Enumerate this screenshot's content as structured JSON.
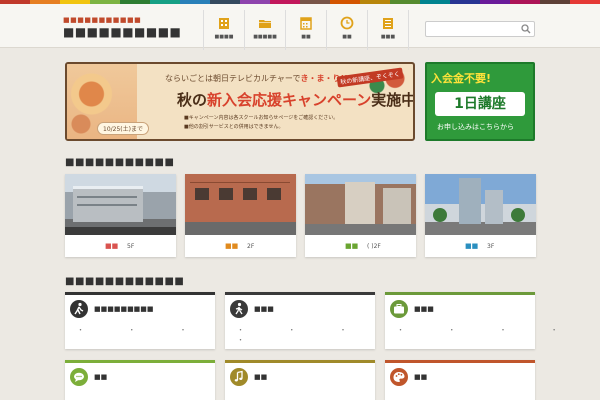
{
  "stripe_colors": [
    "#c0392b",
    "#e67e22",
    "#f1c40f",
    "#7cb342",
    "#2e7d32",
    "#16a085",
    "#2980b9",
    "#34495e",
    "#8e44ad",
    "#c2185b",
    "#795548",
    "#d35400",
    "#b8860b",
    "#558b2f",
    "#00838f",
    "#283593",
    "#6a1b9a",
    "#ad1457",
    "#5d4037",
    "#e53935"
  ],
  "header": {
    "logo_sub": "■■■■■■■■■■■",
    "logo_main": "■■■■■■■■■■",
    "nav": [
      {
        "label": "■■■■",
        "icon": "building-icon"
      },
      {
        "label": "■■■■■",
        "icon": "folder-icon"
      },
      {
        "label": "■■",
        "icon": "calendar-icon"
      },
      {
        "label": "■■",
        "icon": "clock-icon"
      },
      {
        "label": "■■■",
        "icon": "list-icon"
      }
    ],
    "search_placeholder": ""
  },
  "banner_main": {
    "line1": "ならいごとは朝日テレビカルチャーで",
    "line1_accent": "き・ま・り!!",
    "badge": "秋の新講座、ぞくぞく",
    "title_prefix": "秋の",
    "title_accent": "新入会応援キャンペーン",
    "title_suffix": "実施中!",
    "note1": "■キャンペーン内容は各スクールお知らせページをご確認ください。",
    "note2": "■他の割引サービスとの併用はできません。",
    "date": "10/25(土)まで"
  },
  "banner_side": {
    "top": "入会金不要!",
    "box": "1日講座",
    "bottom": "お申し込みはこちらから"
  },
  "schools_title": "■■■■■■■■■■■",
  "schools": [
    {
      "name": "■■",
      "floor": "5F",
      "color": "#d9534f"
    },
    {
      "name": "■■",
      "floor": "2F",
      "color": "#e08a1e"
    },
    {
      "name": "■■",
      "floor": "( )2F",
      "color": "#6aa531"
    },
    {
      "name": "■■",
      "floor": "3F",
      "color": "#2a8fbf"
    }
  ],
  "categories_title": "■■■■■■■■■■■■",
  "categories": [
    {
      "title": "■■■■■■■■■",
      "icon": "hiking-icon",
      "icon_bg": "#333333",
      "border": "#333333",
      "dots": "・ ・ ・ ・",
      "dots2": ""
    },
    {
      "title": "■■■",
      "icon": "walking-icon",
      "icon_bg": "#3a3a3a",
      "border": "#3a3a3a",
      "dots": "・ ・ ・ ・ ・ ・",
      "dots2": "・"
    },
    {
      "title": "■■■",
      "icon": "suitcase-icon",
      "icon_bg": "#6c9a3a",
      "border": "#6c9a3a",
      "dots": "・ ・ ・ ・ ・",
      "dots2": ""
    },
    {
      "title": "■■",
      "icon": "speech-bubble-icon",
      "icon_bg": "#7cae3a",
      "border": "#7cae3a",
      "dots": "",
      "dots2": ""
    },
    {
      "title": "■■",
      "icon": "music-note-icon",
      "icon_bg": "#a08a2a",
      "border": "#a08a2a",
      "dots": "",
      "dots2": ""
    },
    {
      "title": "■■",
      "icon": "palette-icon",
      "icon_bg": "#c0562c",
      "border": "#c0562c",
      "dots": "",
      "dots2": ""
    }
  ]
}
